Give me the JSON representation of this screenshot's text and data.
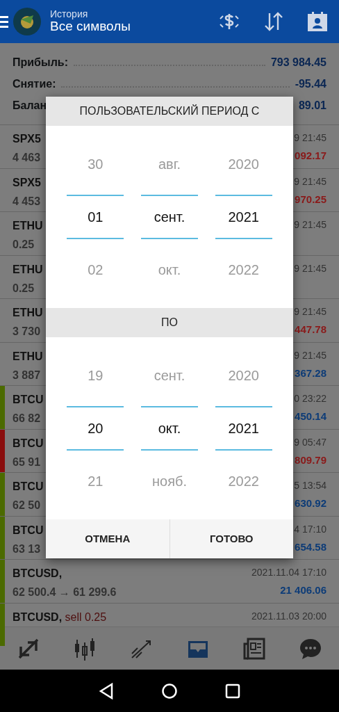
{
  "app_bar": {
    "title": "История",
    "subtitle": "Все символы"
  },
  "summary": [
    {
      "label": "Прибыль:",
      "value": "793 984.45"
    },
    {
      "label": "Снятие:",
      "value": "-95.44"
    },
    {
      "label": "Балан",
      "value": "89.01"
    }
  ],
  "rows": [
    {
      "title": "SPX5",
      "subtitle": "4 463",
      "time": "9 21:45",
      "amount": {
        "text": "092.17",
        "color": "#8b1a1a"
      }
    },
    {
      "title": "SPX5",
      "subtitle": "4 453",
      "time": "9 21:45",
      "amount": {
        "text": "970.25",
        "color": "#8b1a1a"
      }
    },
    {
      "title": "ETHU",
      "subtitle": "0.25",
      "time": "9 21:45"
    },
    {
      "title": "ETHU",
      "subtitle": "0.25",
      "time": "9 21:45"
    },
    {
      "title": "ETHU",
      "subtitle": "3 730",
      "time": "9 21:45",
      "amount": {
        "text": "447.78",
        "color": "#8b1a1a"
      }
    },
    {
      "title": "ETHU",
      "subtitle": "3 887",
      "time": "9 21:45",
      "amount": {
        "text": "367.28",
        "color": "#0d3c78"
      }
    },
    {
      "color": "#4b6a00",
      "title": "BTCU",
      "subtitle": "66 82",
      "time": "0 23:22",
      "amount": {
        "text": "450.14",
        "color": "#0d3c78"
      }
    },
    {
      "color": "#8a0d0d",
      "title": "BTCU",
      "subtitle": "65 91",
      "time": "9 05:47",
      "amount": {
        "text": "809.79",
        "color": "#8b1a1a"
      }
    },
    {
      "color": "#4b6a00",
      "title": "BTCU",
      "subtitle": "62 50",
      "time": "5 13:54",
      "amount": {
        "text": "630.92",
        "color": "#0d3c78"
      }
    },
    {
      "color": "#4b6a00",
      "title": "BTCU",
      "subtitle": "63 13",
      "time": "4 17:10",
      "amount": {
        "text": "654.58",
        "color": "#0d3c78"
      }
    },
    {
      "color": "#4b6a00",
      "title": "BTCUSD,",
      "subtitle": "62 500.4 → 61 299.6",
      "time": "2021.11.04 17:10",
      "amount": {
        "text": "21 406.06",
        "color": "#0d3c78"
      }
    },
    {
      "color": "#4b6a00",
      "title": "BTCUSD,",
      "action": "sell 0.25",
      "time": "2021.11.03 20:00"
    }
  ],
  "bottom_nav": [
    {
      "selected": false
    },
    {
      "selected": false
    },
    {
      "selected": false
    },
    {
      "selected": true
    },
    {
      "selected": false
    },
    {
      "selected": false
    }
  ],
  "dialog": {
    "pickers": [
      {
        "header": "ПОЛЬЗОВАТЕЛЬСКИЙ ПЕРИОД С",
        "columns": [
          {
            "items": [
              {
                "text": "30",
                "selected": false
              },
              {
                "text": "01",
                "selected": true
              },
              {
                "text": "02",
                "selected": false
              }
            ]
          },
          {
            "items": [
              {
                "text": "авг.",
                "selected": false
              },
              {
                "text": "сент.",
                "selected": true
              },
              {
                "text": "окт.",
                "selected": false
              }
            ]
          },
          {
            "items": [
              {
                "text": "2020",
                "selected": false
              },
              {
                "text": "2021",
                "selected": true
              },
              {
                "text": "2022",
                "selected": false
              }
            ]
          }
        ]
      },
      {
        "header": "ПО",
        "columns": [
          {
            "items": [
              {
                "text": "19",
                "selected": false
              },
              {
                "text": "20",
                "selected": true
              },
              {
                "text": "21",
                "selected": false
              }
            ]
          },
          {
            "items": [
              {
                "text": "сент.",
                "selected": false
              },
              {
                "text": "окт.",
                "selected": true
              },
              {
                "text": "нояб.",
                "selected": false
              }
            ]
          },
          {
            "items": [
              {
                "text": "2020",
                "selected": false
              },
              {
                "text": "2021",
                "selected": true
              },
              {
                "text": "2022",
                "selected": false
              }
            ]
          }
        ]
      }
    ],
    "buttons": [
      "ОТМЕНА",
      "ГОТОВО"
    ]
  }
}
